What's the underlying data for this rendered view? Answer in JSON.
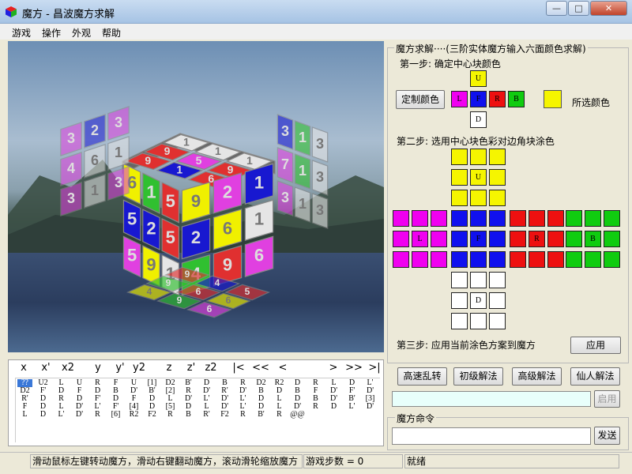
{
  "window": {
    "title": "魔方 - 昌波魔方求解",
    "minimize_icon": "minimize-icon",
    "maximize_icon": "maximize-icon",
    "close_icon": "close-icon",
    "min_glyph": "—",
    "max_glyph": "□",
    "close_glyph": "✕"
  },
  "menu": {
    "items": [
      "游戏",
      "操作",
      "外观",
      "帮助"
    ]
  },
  "cube": {
    "top": [
      [
        "#e5e5e5",
        "1",
        "#e5e5e5",
        "1",
        "#e5e5e5",
        "1"
      ],
      [
        "#e03030",
        "9",
        "#e040e0",
        "5",
        "#e03030",
        "9"
      ],
      [
        "#e03030",
        "9",
        "#1818d0",
        "1",
        "#e03030",
        "6"
      ]
    ],
    "front_left": [
      [
        "#f0f000",
        "6",
        "#30c030",
        "1",
        "#e03030",
        "5"
      ],
      [
        "#1818d0",
        "5",
        "#1818d0",
        "2",
        "#e03030",
        "5"
      ],
      [
        "#e040e0",
        "5",
        "#f0f000",
        "9",
        "#e5e5e5",
        "1"
      ]
    ],
    "front_right": [
      [
        "#f0f000",
        "9",
        "#e040e0",
        "2",
        "#1818d0",
        "1"
      ],
      [
        "#1818d0",
        "2",
        "#f0f000",
        "6",
        "#e5e5e5",
        "1"
      ],
      [
        "#30c030",
        "4",
        "#e03030",
        "9",
        "#e040e0",
        "6"
      ]
    ],
    "left_float": [
      [
        "#e040e0",
        "3",
        "#1818d0",
        "2",
        "#e040e0",
        "3"
      ],
      [
        "#e040e0",
        "4",
        "#e5e5e5",
        "6",
        "#e5e5e5",
        "1"
      ],
      [
        "#e040e0",
        "3",
        "#e5e5e5",
        "1",
        "#e040e0",
        "3"
      ]
    ],
    "right_float": [
      [
        "#1818d0",
        "3",
        "#30c030",
        "1",
        "#e5e5e5",
        "3"
      ],
      [
        "#e040e0",
        "7",
        "#30c030",
        "1",
        "#e5e5e5",
        "3"
      ],
      [
        "#e040e0",
        "3",
        "#e5e5e5",
        "1",
        "#e5e5e5",
        "3"
      ]
    ],
    "reflection": [
      [
        "#e03030",
        "9",
        "#1818d0",
        "4",
        "#e03030",
        "5"
      ],
      [
        "#30c030",
        "9",
        "#e03030",
        "6",
        "#f0f000",
        "6"
      ],
      [
        "#f0f000",
        "4",
        "#30c030",
        "9",
        "#e040e0",
        "6"
      ]
    ]
  },
  "commands": {
    "buttons": [
      "x",
      "x'",
      "x2",
      "y",
      "y'",
      "y2",
      "z",
      "z'",
      "z2",
      "|<",
      "<<",
      "<",
      ">",
      ">>",
      ">|"
    ]
  },
  "history": {
    "rows": [
      [
        "??",
        "U2",
        "L",
        "U",
        "R",
        "F",
        "U",
        "[1]",
        "D2",
        "B'",
        "D",
        "B",
        "R",
        "D2",
        "R2",
        "D",
        "R",
        "L",
        "D",
        "L'"
      ],
      [
        "D2",
        "F'",
        "D",
        "F",
        "D",
        "B",
        "D'",
        "B'",
        "[2]",
        "R",
        "D'",
        "R'",
        "D'",
        "B",
        "D",
        "B",
        "F",
        "D'",
        "F'",
        "D'"
      ],
      [
        "R'",
        "D",
        "R",
        "D",
        "F'",
        "D",
        "F",
        "D",
        "L",
        "D'",
        "L'",
        "D'",
        "L'",
        "D",
        "L",
        "D",
        "B",
        "D'",
        "B'",
        "[3]"
      ],
      [
        "F",
        "D",
        "L",
        "D'",
        "L'",
        "F'",
        "[4]",
        "D",
        "[5]",
        "D",
        "L",
        "D'",
        "L'",
        "D",
        "L",
        "D'",
        "R",
        "D",
        "L'",
        "D'"
      ],
      [
        "L",
        "D",
        "L'",
        "D'",
        "R",
        "[6]",
        "R2",
        "F2",
        "R",
        "B",
        "R'",
        "F2",
        "R",
        "B'",
        "R",
        "@@",
        "",
        "",
        "",
        ""
      ]
    ]
  },
  "panel": {
    "solve_group_title": "魔方求解····(三阶实体魔方输入六面颜色求解)",
    "step1": "第一步: 确定中心块颜色",
    "custom_color_button": "定制颜色",
    "selected_color_label": "所选颜色",
    "selected_color": "#f5f500",
    "center_U": "U",
    "center_L": "L",
    "center_F": "F",
    "center_R": "R",
    "center_B": "B",
    "center_D": "D",
    "center_colors": {
      "U": "#f5f500",
      "L": "#f000f0",
      "F": "#1010ee",
      "R": "#ee1010",
      "B": "#10cc10",
      "D": "#ffffff"
    },
    "step2": "第二步: 选用中心块色彩对边角块涂色",
    "step3": "第三步: 应用当前涂色方案到魔方",
    "apply_button": "应用",
    "scramble_button": "高速乱转",
    "beginner_button": "初级解法",
    "advanced_button": "高级解法",
    "fairy_button": "仙人解法",
    "enable_button": "启用",
    "command_group_title": "魔方命令",
    "send_button": "发送"
  },
  "status": {
    "hint": "滑动鼠标左键转动魔方，滑动右键翻动魔方，滚动滑轮缩放魔方",
    "steps": "游戏步数 = 0",
    "state": "就绪"
  }
}
